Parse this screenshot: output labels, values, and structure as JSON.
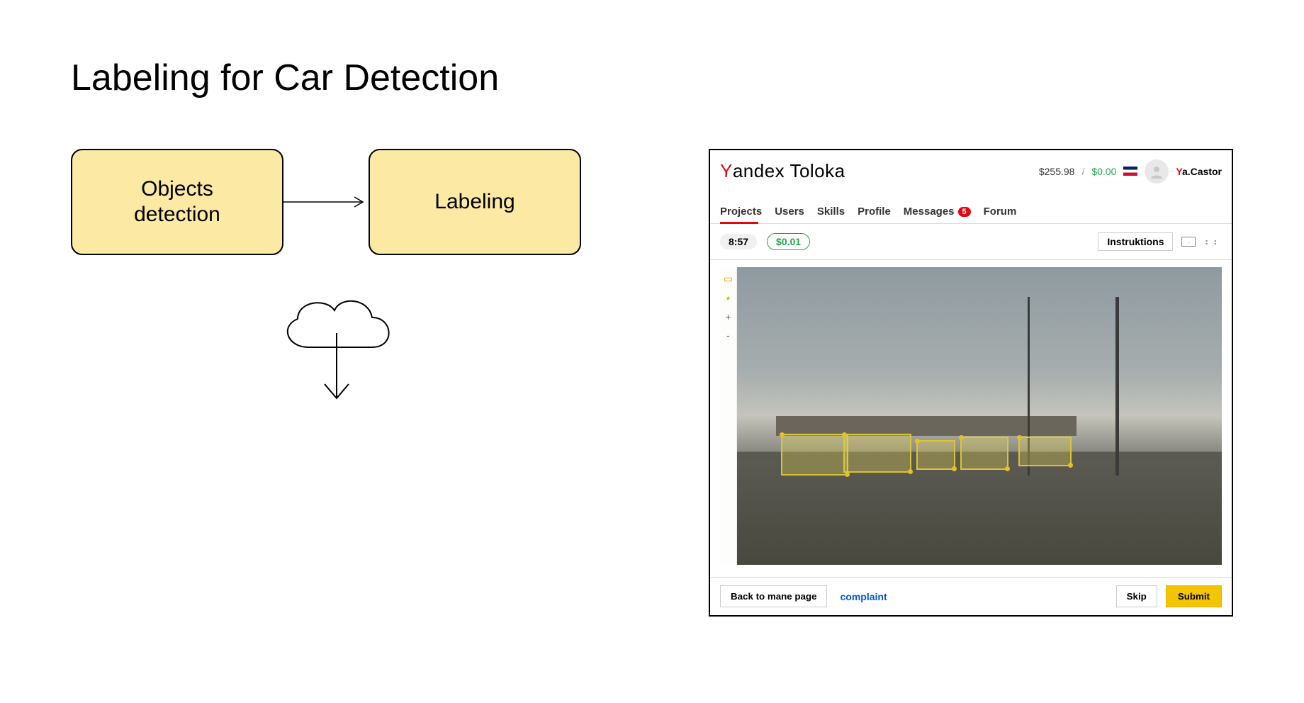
{
  "title": "Labeling for Car Detection",
  "flow": {
    "box1": "Objects\ndetection",
    "box2": "Labeling"
  },
  "toloka": {
    "brand": {
      "prefix": "Y",
      "rest": "andex Toloka"
    },
    "balance1": "$255.98",
    "balance2": "$0.00",
    "slash": "/",
    "username_prefix": "Y",
    "username_rest": "a.Castor",
    "nav": {
      "projects": "Projects",
      "users": "Users",
      "skills": "Skills",
      "profile": "Profile",
      "messages": "Messages",
      "messages_count": "5",
      "forum": "Forum"
    },
    "task": {
      "timer": "8:57",
      "price": "$0.01",
      "instructions": "Instruktions"
    },
    "tools": {
      "zoom_in": "+",
      "zoom_out": "-"
    },
    "footer": {
      "back": "Back to mane page",
      "complaint": "complaint",
      "skip": "Skip",
      "submit": "Submit"
    }
  }
}
